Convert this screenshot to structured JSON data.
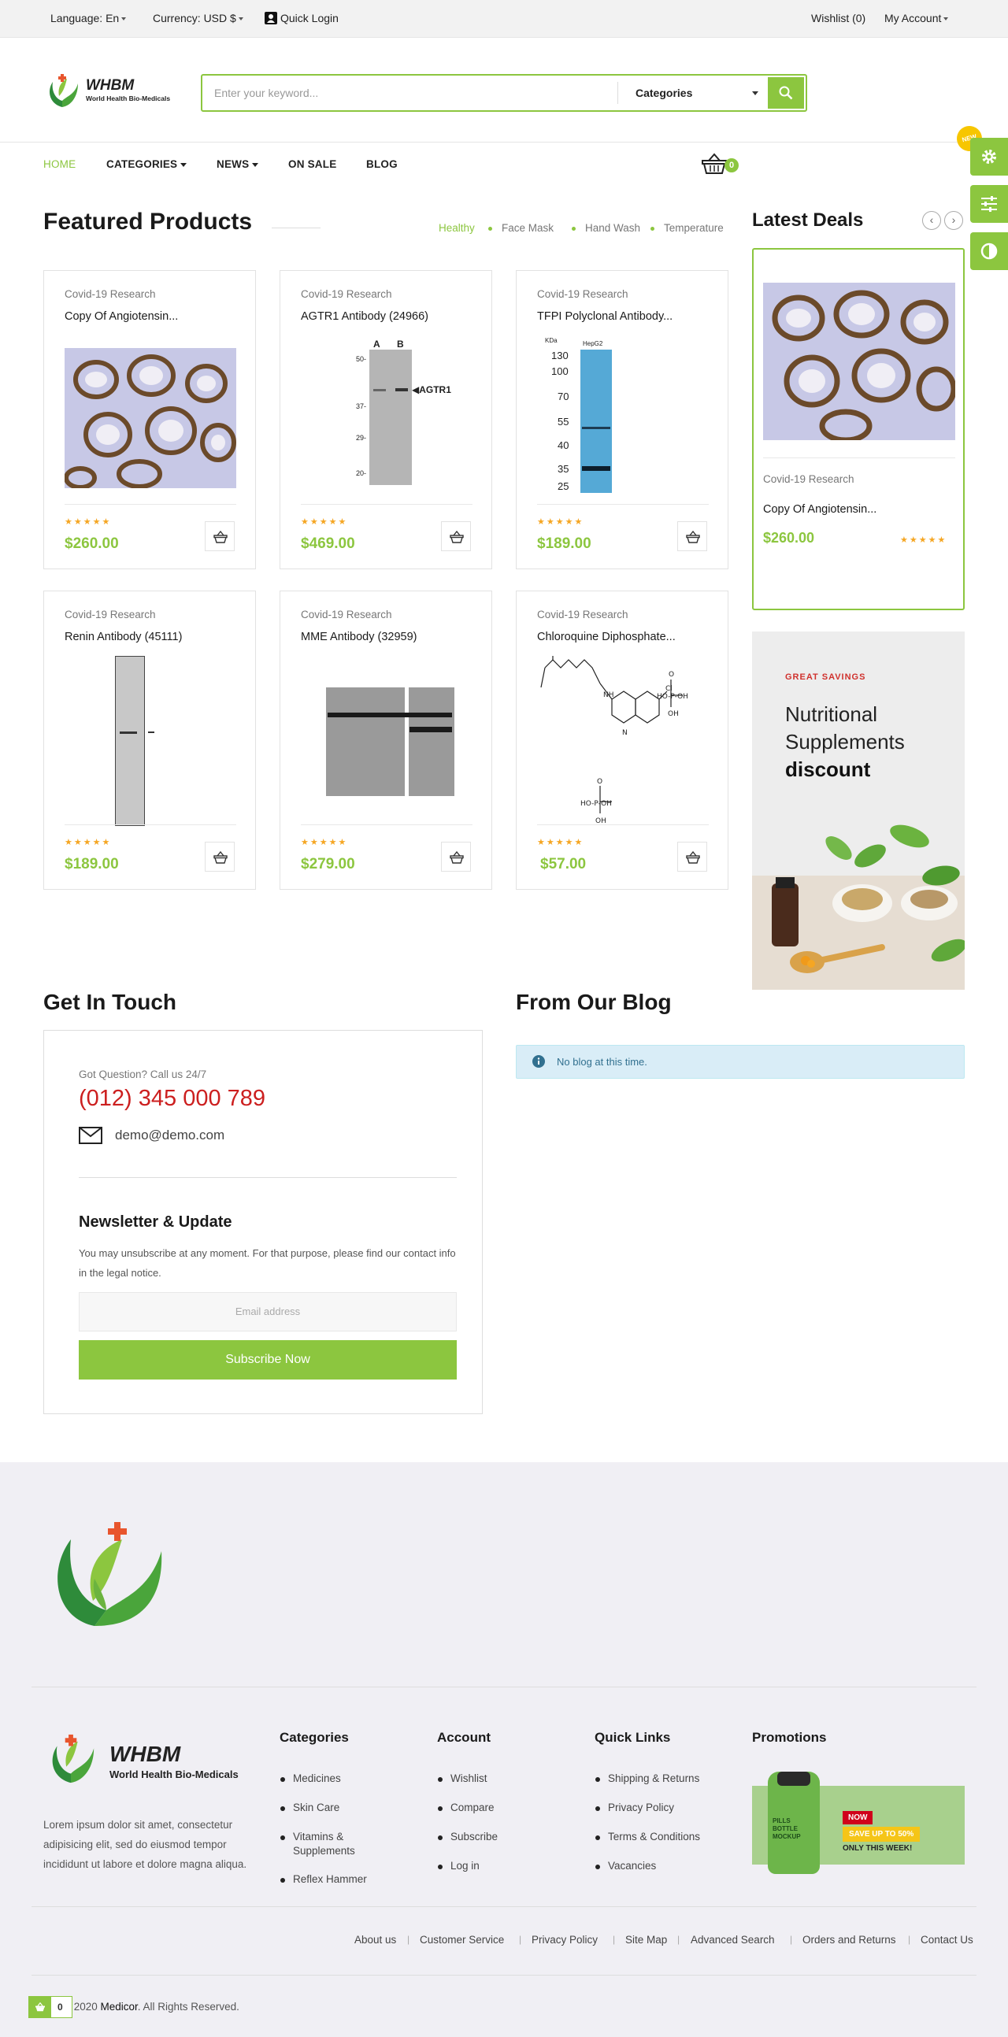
{
  "topbar": {
    "language": "Language: En",
    "currency": "Currency: USD $",
    "quick_login": "Quick Login",
    "wishlist": "Wishlist (0)",
    "my_account": "My Account"
  },
  "header": {
    "logo_name": "WHBM",
    "logo_tagline": "World Health Bio-Medicals",
    "search_placeholder": "Enter your keyword...",
    "categories_label": "Categories",
    "cart_count": "0",
    "new_badge": "NEW"
  },
  "nav": {
    "items": [
      "HOME",
      "CATEGORIES",
      "NEWS",
      "ON SALE",
      "BLOG"
    ]
  },
  "featured": {
    "title": "Featured Products",
    "filters": [
      "Healthy",
      "Face Mask",
      "Hand Wash",
      "Temperature"
    ],
    "products": [
      {
        "category": "Covid-19 Research",
        "name": "Copy Of Angiotensin...",
        "price": "$260.00",
        "stars": "★★★★★"
      },
      {
        "category": "Covid-19 Research",
        "name": "AGTR1 Antibody (24966)",
        "price": "$469.00",
        "stars": "★★★★★"
      },
      {
        "category": "Covid-19 Research",
        "name": "TFPI Polyclonal Antibody...",
        "price": "$189.00",
        "stars": "★★★★★"
      },
      {
        "category": "Covid-19 Research",
        "name": "Renin Antibody (45111)",
        "price": "$189.00",
        "stars": "★★★★★"
      },
      {
        "category": "Covid-19 Research",
        "name": "MME Antibody (32959)",
        "price": "$279.00",
        "stars": "★★★★★"
      },
      {
        "category": "Covid-19 Research",
        "name": "Chloroquine Diphosphate...",
        "price": "$57.00",
        "stars": "★★★★★"
      }
    ],
    "blot_labels": {
      "agtr1_lanes": [
        "A",
        "B"
      ],
      "agtr1_marks": [
        "50-",
        "37-",
        "29-",
        "20-"
      ],
      "agtr1_target": "◀AGTR1",
      "tfpi_kda": "KDa",
      "tfpi_lane": "HepG2",
      "tfpi_marks": [
        "130",
        "100",
        "70",
        "55",
        "40",
        "35",
        "25"
      ]
    }
  },
  "latest_deals": {
    "title": "Latest Deals",
    "category": "Covid-19 Research",
    "name": "Copy Of Angiotensin...",
    "price": "$260.00",
    "stars": "★★★★★"
  },
  "banner": {
    "eyebrow": "GREAT SAVINGS",
    "line1": "Nutritional",
    "line2": "Supplements",
    "line3": "discount"
  },
  "contact": {
    "title": "Get In Touch",
    "question": "Got Question? Call us 24/7",
    "phone": "(012) 345 000 789",
    "email": "demo@demo.com",
    "newsletter_title": "Newsletter & Update",
    "newsletter_text": "You may unsubscribe at any moment. For that purpose, please find our contact info in the legal notice.",
    "email_placeholder": "Email address",
    "subscribe": "Subscribe Now"
  },
  "blog": {
    "title": "From Our Blog",
    "alert": "No blog at this time."
  },
  "footer": {
    "logo_name": "WHBM",
    "logo_tagline": "World Health Bio-Medicals",
    "about": "Lorem ipsum dolor sit amet, consectetur adipisicing elit, sed do eiusmod tempor incididunt ut labore et dolore magna aliqua.",
    "categories": {
      "title": "Categories",
      "links": [
        "Medicines",
        "Skin Care",
        "Vitamins &",
        "Supplements",
        "Reflex Hammer"
      ]
    },
    "account": {
      "title": "Account",
      "links": [
        "Wishlist",
        "Compare",
        "Subscribe",
        "Log in"
      ]
    },
    "quick_links": {
      "title": "Quick Links",
      "links": [
        "Shipping & Returns",
        "Privacy Policy",
        "Terms & Conditions",
        "Vacancies"
      ]
    },
    "promotions": {
      "title": "Promotions",
      "promo_now": "NOW",
      "promo_save": "SAVE UP TO 50%",
      "promo_only": "ONLY THIS WEEK!",
      "bottle_text": "PILLS BOTTLE MOCKUP"
    },
    "bottom_links": [
      "About us",
      "Customer Service",
      "Privacy Policy",
      "Site Map",
      "Advanced Search",
      "Orders and Returns",
      "Contact Us"
    ],
    "copyright_pre": "ht © 2020 ",
    "copyright_brand": "Medicor",
    "copyright_post": ". All Rights Reserved.",
    "mini_cart_count": "0"
  },
  "colors": {
    "accent": "#8cc63f",
    "phone_red": "#cc1f1f",
    "star": "#f5a623"
  }
}
